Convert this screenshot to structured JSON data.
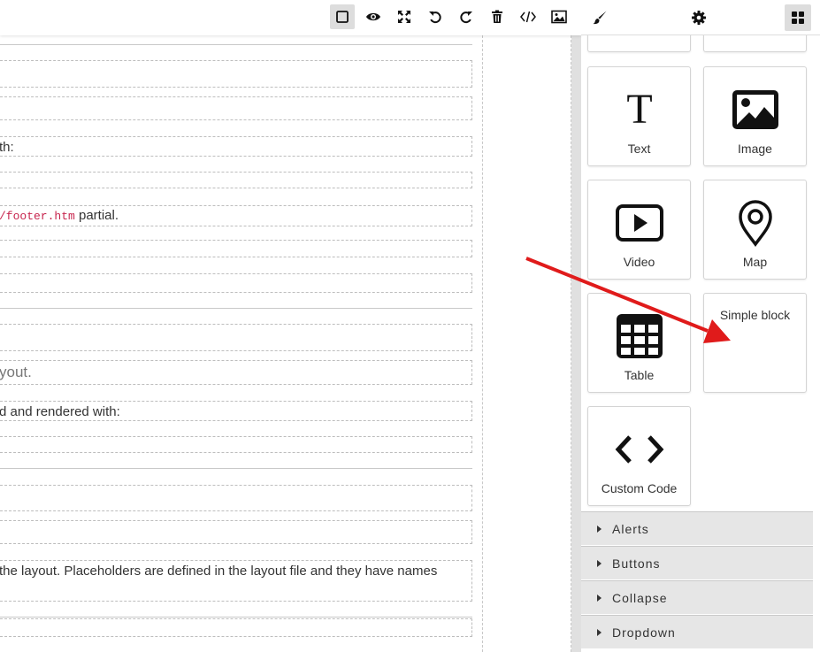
{
  "toolbar": {
    "tools": [
      {
        "name": "sw-visibility",
        "icon": "square-icon"
      },
      {
        "name": "preview",
        "icon": "eye-icon"
      },
      {
        "name": "fullscreen",
        "icon": "expand-icon"
      },
      {
        "name": "undo",
        "icon": "undo-icon"
      },
      {
        "name": "redo",
        "icon": "redo-icon"
      },
      {
        "name": "clear",
        "icon": "trash-icon"
      },
      {
        "name": "export-code",
        "icon": "code-icon"
      },
      {
        "name": "assets",
        "icon": "image-icon"
      }
    ],
    "panel_tabs": [
      {
        "name": "style-manager",
        "icon": "paintbrush-icon"
      },
      {
        "name": "settings",
        "icon": "gear-icon"
      },
      {
        "name": "blocks",
        "icon": "grid-icon"
      }
    ]
  },
  "canvas": {
    "rows": [
      {
        "text": ""
      },
      {
        "text": ""
      },
      {
        "text": "th:"
      },
      {
        "text": ""
      },
      {
        "code": "/footer.htm",
        "text": " partial."
      },
      {
        "text": ""
      },
      {
        "text": ""
      },
      {
        "text": ""
      },
      {
        "text": "yout."
      },
      {
        "text": "d and rendered with:"
      },
      {
        "text": ""
      },
      {
        "text": ""
      },
      {
        "text": ""
      },
      {
        "text": "the layout. Placeholders are defined in the layout file and they have names"
      },
      {
        "text": ""
      }
    ]
  },
  "blocks": [
    {
      "label": "Text",
      "icon": "text-icon"
    },
    {
      "label": "Image",
      "icon": "image-icon"
    },
    {
      "label": "Video",
      "icon": "play-icon"
    },
    {
      "label": "Map",
      "icon": "map-pin-icon"
    },
    {
      "label": "Table",
      "icon": "table-icon"
    },
    {
      "label": "Simple block",
      "icon": ""
    },
    {
      "label": "Custom Code",
      "icon": "code-icon"
    }
  ],
  "categories": [
    {
      "label": "Alerts"
    },
    {
      "label": "Buttons"
    },
    {
      "label": "Collapse"
    },
    {
      "label": "Dropdown"
    }
  ],
  "colors": {
    "arrow": "#e01b1b",
    "code": "#c7254e",
    "category_bg": "#e6e6e6"
  }
}
